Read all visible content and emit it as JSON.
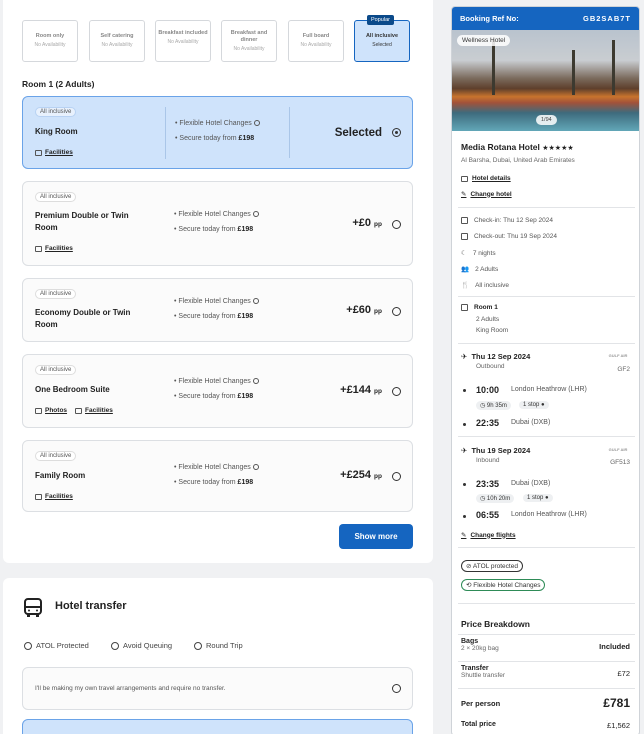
{
  "boards": [
    {
      "title": "Room only",
      "status": "No Availability"
    },
    {
      "title": "Self catering",
      "status": "No Availability"
    },
    {
      "title": "Breakfast included",
      "status": "No Availability"
    },
    {
      "title": "Breakfast and dinner",
      "status": "No Availability"
    },
    {
      "title": "Full board",
      "status": "No Availability"
    },
    {
      "title": "All inclusive",
      "status": "Selected",
      "badge": "Popular"
    }
  ],
  "room_heading": "Room 1 (2 Adults)",
  "rooms": [
    {
      "tag": "All inclusive",
      "name": "King Room",
      "f1": "Flexible Hotel Changes",
      "f2": "Secure today from ",
      "f2v": "£198",
      "price": "Selected",
      "pp": "",
      "facilities": "Facilities"
    },
    {
      "tag": "All inclusive",
      "name": "Premium Double or Twin Room",
      "f1": "Flexible Hotel Changes",
      "f2": "Secure today from ",
      "f2v": "£198",
      "price": "+£0",
      "pp": "pp",
      "facilities": "Facilities"
    },
    {
      "tag": "All inclusive",
      "name": "Economy Double or Twin Room",
      "f1": "Flexible Hotel Changes",
      "f2": "Secure today from ",
      "f2v": "£198",
      "price": "+£60",
      "pp": "pp",
      "facilities": "Facilities"
    },
    {
      "tag": "All inclusive",
      "name": "One Bedroom Suite",
      "f1": "Flexible Hotel Changes",
      "f2": "Secure today from ",
      "f2v": "£198",
      "price": "+£144",
      "pp": "pp",
      "facilities": "Facilities",
      "photos": "Photos"
    },
    {
      "tag": "All inclusive",
      "name": "Family Room",
      "f1": "Flexible Hotel Changes",
      "f2": "Secure today from ",
      "f2v": "£198",
      "price": "+£254",
      "pp": "pp",
      "facilities": "Facilities"
    }
  ],
  "show_more": "Show more",
  "transfer": {
    "title": "Hotel transfer",
    "features": [
      "ATOL Protected",
      "Avoid Queuing",
      "Round Trip"
    ],
    "no_transfer": "I'll be making my own travel arrangements and require no transfer."
  },
  "booking": {
    "ref_label": "Booking Ref No:",
    "ref": "GB2SAB7T",
    "photo_tag": "Wellness Hotel",
    "photo_count": "1/94",
    "hotel": "Media Rotana Hotel",
    "stars": "★★★★★",
    "location": "Al Barsha, Dubai, United Arab Emirates",
    "hotel_details": "Hotel details",
    "change_hotel": "Change hotel",
    "checkin": "Check-in: Thu 12 Sep 2024",
    "checkout": "Check-out: Thu 19 Sep 2024",
    "nights": "7 nights",
    "adults": "2 Adults",
    "board": "All inclusive",
    "room_label": "Room 1",
    "room_adults": "2 Adults",
    "room_type": "King Room",
    "outbound": {
      "date": "Thu 12 Sep 2024",
      "label": "Outbound",
      "code": "GF2",
      "dep_time": "10:00",
      "dep": "London Heathrow (LHR)",
      "duration": "9h 35m",
      "stops": "1 stop",
      "arr_time": "22:35",
      "arr": "Dubai (DXB)"
    },
    "inbound": {
      "date": "Thu 19 Sep 2024",
      "label": "Inbound",
      "code": "GF513",
      "dep_time": "23:35",
      "dep": "Dubai (DXB)",
      "duration": "10h 20m",
      "stops": "1 stop",
      "arr_time": "06:55",
      "arr": "London Heathrow (LHR)"
    },
    "airline_logo": "GULF AIR",
    "change_flights": "Change flights",
    "atol": "ATOL protected",
    "flex": "Flexible Hotel Changes",
    "price_breakdown": "Price Breakdown",
    "bags_label": "Bags",
    "bags_sub": "2 × 20kg bag",
    "bags_val": "Included",
    "transfer_label": "Transfer",
    "transfer_sub": "Shuttle transfer",
    "transfer_val": "£72",
    "pp_label": "Per person",
    "pp_val": "£781",
    "total_label": "Total price",
    "total_val": "£1,562"
  }
}
